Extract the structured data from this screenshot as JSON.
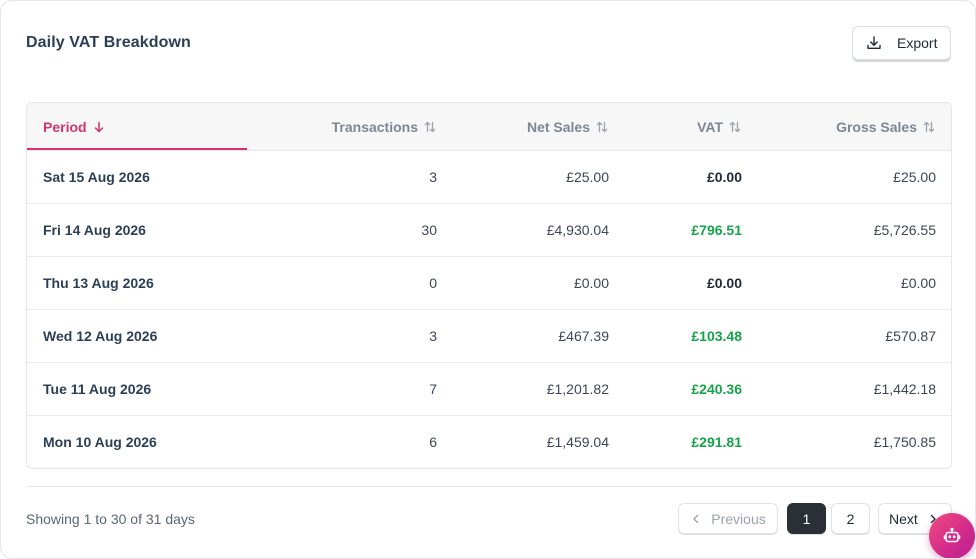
{
  "card": {
    "title": "Daily VAT Breakdown"
  },
  "export_button": {
    "label": "Export",
    "icon": "download-icon"
  },
  "table": {
    "headers": {
      "period": "Period",
      "transactions": "Transactions",
      "net_sales": "Net Sales",
      "vat": "VAT",
      "gross_sales": "Gross Sales"
    },
    "sort": {
      "column": "period",
      "direction": "descending"
    },
    "rows": [
      {
        "period": "Sat 15 Aug 2026",
        "transactions": "3",
        "net_sales": "£25.00",
        "vat": "£0.00",
        "vat_positive": false,
        "gross_sales": "£25.00"
      },
      {
        "period": "Fri 14 Aug 2026",
        "transactions": "30",
        "net_sales": "£4,930.04",
        "vat": "£796.51",
        "vat_positive": true,
        "gross_sales": "£5,726.55"
      },
      {
        "period": "Thu 13 Aug 2026",
        "transactions": "0",
        "net_sales": "£0.00",
        "vat": "£0.00",
        "vat_positive": false,
        "gross_sales": "£0.00"
      },
      {
        "period": "Wed 12 Aug 2026",
        "transactions": "3",
        "net_sales": "£467.39",
        "vat": "£103.48",
        "vat_positive": true,
        "gross_sales": "£570.87"
      },
      {
        "period": "Tue 11 Aug 2026",
        "transactions": "7",
        "net_sales": "£1,201.82",
        "vat": "£240.36",
        "vat_positive": true,
        "gross_sales": "£1,442.18"
      },
      {
        "period": "Mon 10 Aug 2026",
        "transactions": "6",
        "net_sales": "£1,459.04",
        "vat": "£291.81",
        "vat_positive": true,
        "gross_sales": "£1,750.85"
      }
    ]
  },
  "footer": {
    "summary": "Showing 1 to 30 of 31 days",
    "pagination": {
      "previous_label": "Previous",
      "next_label": "Next",
      "pages": [
        "1",
        "2"
      ],
      "current_page": "1"
    }
  },
  "assistant_button": {
    "icon": "bot-icon"
  },
  "colors": {
    "accent": "#d6336c",
    "vat_positive": "#16a34a",
    "title": "#2b3f57",
    "active_page": "#2b2f36"
  }
}
